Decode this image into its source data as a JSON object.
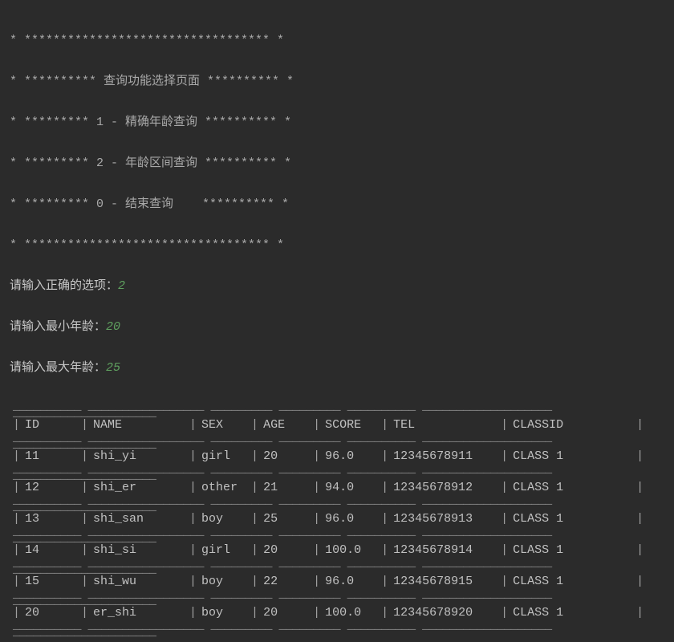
{
  "menu": {
    "border_top": "* ********************************** *",
    "title_line": "* ********** 查询功能选择页面 ********** *",
    "option1_line": "* ********* 1 - 精确年龄查询 ********** *",
    "option2_line": "* ********* 2 - 年龄区间查询 ********** *",
    "option0_line": "* ********* 0 - 结束查询    ********** *",
    "border_bottom": "* ********************************** *"
  },
  "prompts": {
    "choice_label": "请输入正确的选项：",
    "choice_value": "2",
    "min_age_label": "请输入最小年龄：",
    "min_age_value": "20",
    "max_age_label": "请输入最大年龄：",
    "max_age_value": "25"
  },
  "table": {
    "headers": {
      "id": "ID",
      "name": "NAME",
      "sex": "SEX",
      "age": "AGE",
      "score": "SCORE",
      "tel": "TEL",
      "classid": "CLASSID"
    },
    "rows": [
      {
        "id": "11",
        "name": "shi_yi",
        "sex": "girl",
        "age": "20",
        "score": "96.0",
        "tel": "12345678911",
        "classid": "CLASS 1"
      },
      {
        "id": "12",
        "name": "shi_er",
        "sex": "other",
        "age": "21",
        "score": "94.0",
        "tel": "12345678912",
        "classid": "CLASS 1"
      },
      {
        "id": "13",
        "name": "shi_san",
        "sex": "boy",
        "age": "25",
        "score": "96.0",
        "tel": "12345678913",
        "classid": "CLASS 1"
      },
      {
        "id": "14",
        "name": "shi_si",
        "sex": "girl",
        "age": "20",
        "score": "100.0",
        "tel": "12345678914",
        "classid": "CLASS 1"
      },
      {
        "id": "15",
        "name": "shi_wu",
        "sex": "boy",
        "age": "22",
        "score": "96.0",
        "tel": "12345678915",
        "classid": "CLASS 1"
      },
      {
        "id": "20",
        "name": "er_shi",
        "sex": "boy",
        "age": "20",
        "score": "100.0",
        "tel": "12345678920",
        "classid": "CLASS 1"
      }
    ]
  }
}
